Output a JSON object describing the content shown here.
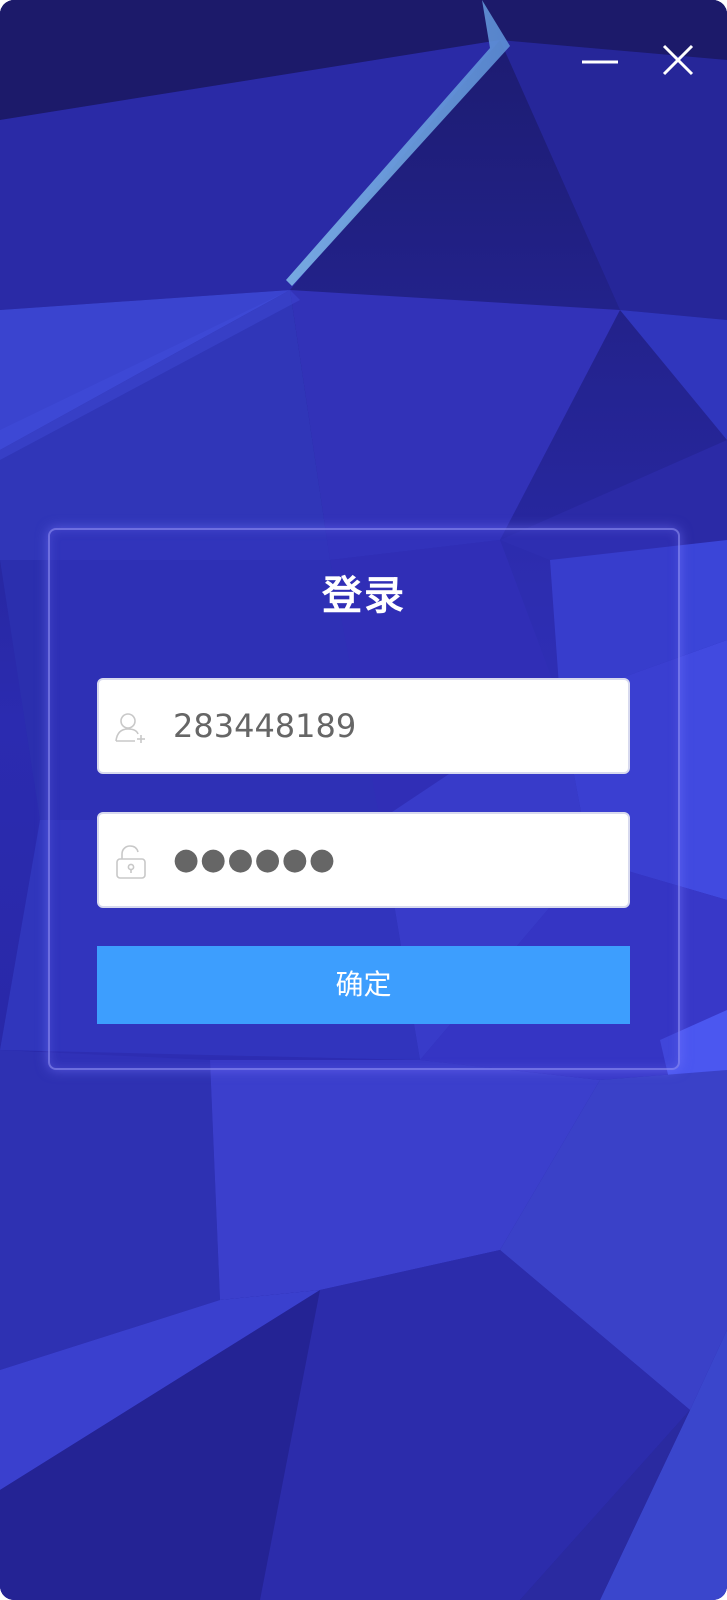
{
  "window": {
    "icons": {
      "minimize": "minimize-icon",
      "close": "close-icon"
    }
  },
  "login": {
    "title": "登录",
    "username": {
      "value": "283448189",
      "icon": "user-icon"
    },
    "password": {
      "value": "●●●●●●",
      "icon": "unlock-icon"
    },
    "submit_label": "确定"
  },
  "colors": {
    "background": "#2a2aa8",
    "accent": "#3d9efe",
    "field_bg": "#ffffff",
    "field_text": "#666666",
    "title_text": "#ffffff"
  }
}
